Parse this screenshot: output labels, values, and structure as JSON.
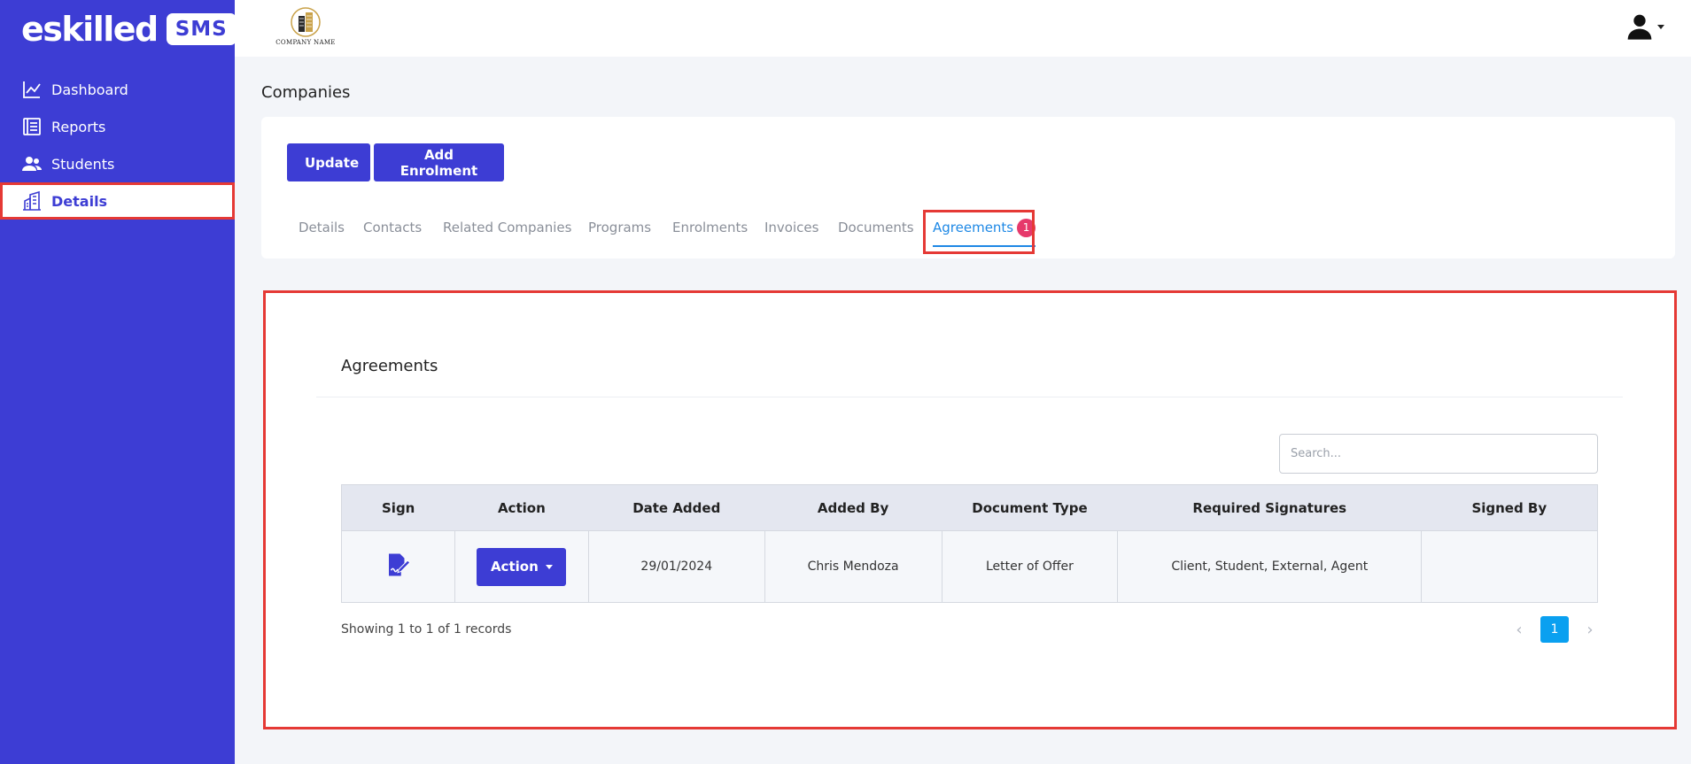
{
  "brand": {
    "logo": "eskilled",
    "badge": "SMS",
    "collapse_glyph": "«"
  },
  "sidebar": {
    "items": [
      {
        "label": "Dashboard",
        "icon": "chart-line-icon"
      },
      {
        "label": "Reports",
        "icon": "reports-icon"
      },
      {
        "label": "Students",
        "icon": "users-icon"
      },
      {
        "label": "Details",
        "icon": "building-icon",
        "active": true
      }
    ]
  },
  "topbar": {
    "company_logo_text": "COMPANY NAME",
    "user_icon": "user-icon"
  },
  "page": {
    "title": "Companies"
  },
  "toolbar": {
    "update_label": "Update",
    "add_enrolment_label": "Add Enrolment"
  },
  "tabs": [
    {
      "label": "Details"
    },
    {
      "label": "Contacts"
    },
    {
      "label": "Related Companies"
    },
    {
      "label": "Programs"
    },
    {
      "label": "Enrolments"
    },
    {
      "label": "Invoices"
    },
    {
      "label": "Documents"
    },
    {
      "label": "Agreements",
      "badge": "1",
      "active": true
    }
  ],
  "agreements": {
    "title": "Agreements",
    "search_placeholder": "Search...",
    "columns": [
      "Sign",
      "Action",
      "Date Added",
      "Added By",
      "Document Type",
      "Required Signatures",
      "Signed By"
    ],
    "rows": [
      {
        "sign_icon": "sign-document-icon",
        "action_label": "Action",
        "date_added": "29/01/2024",
        "added_by": "Chris Mendoza",
        "document_type": "Letter of Offer",
        "required_signatures": "Client, Student, External, Agent",
        "signed_by": ""
      }
    ],
    "showing": "Showing 1 to 1 of 1 records",
    "pagination": {
      "prev": "‹",
      "current": "1",
      "next": "›"
    }
  },
  "colors": {
    "primary": "#3d3dd4",
    "highlight": "#e53935",
    "tab_active": "#1e88e5",
    "badge": "#e6396b",
    "page_btn": "#0aa0f0"
  }
}
